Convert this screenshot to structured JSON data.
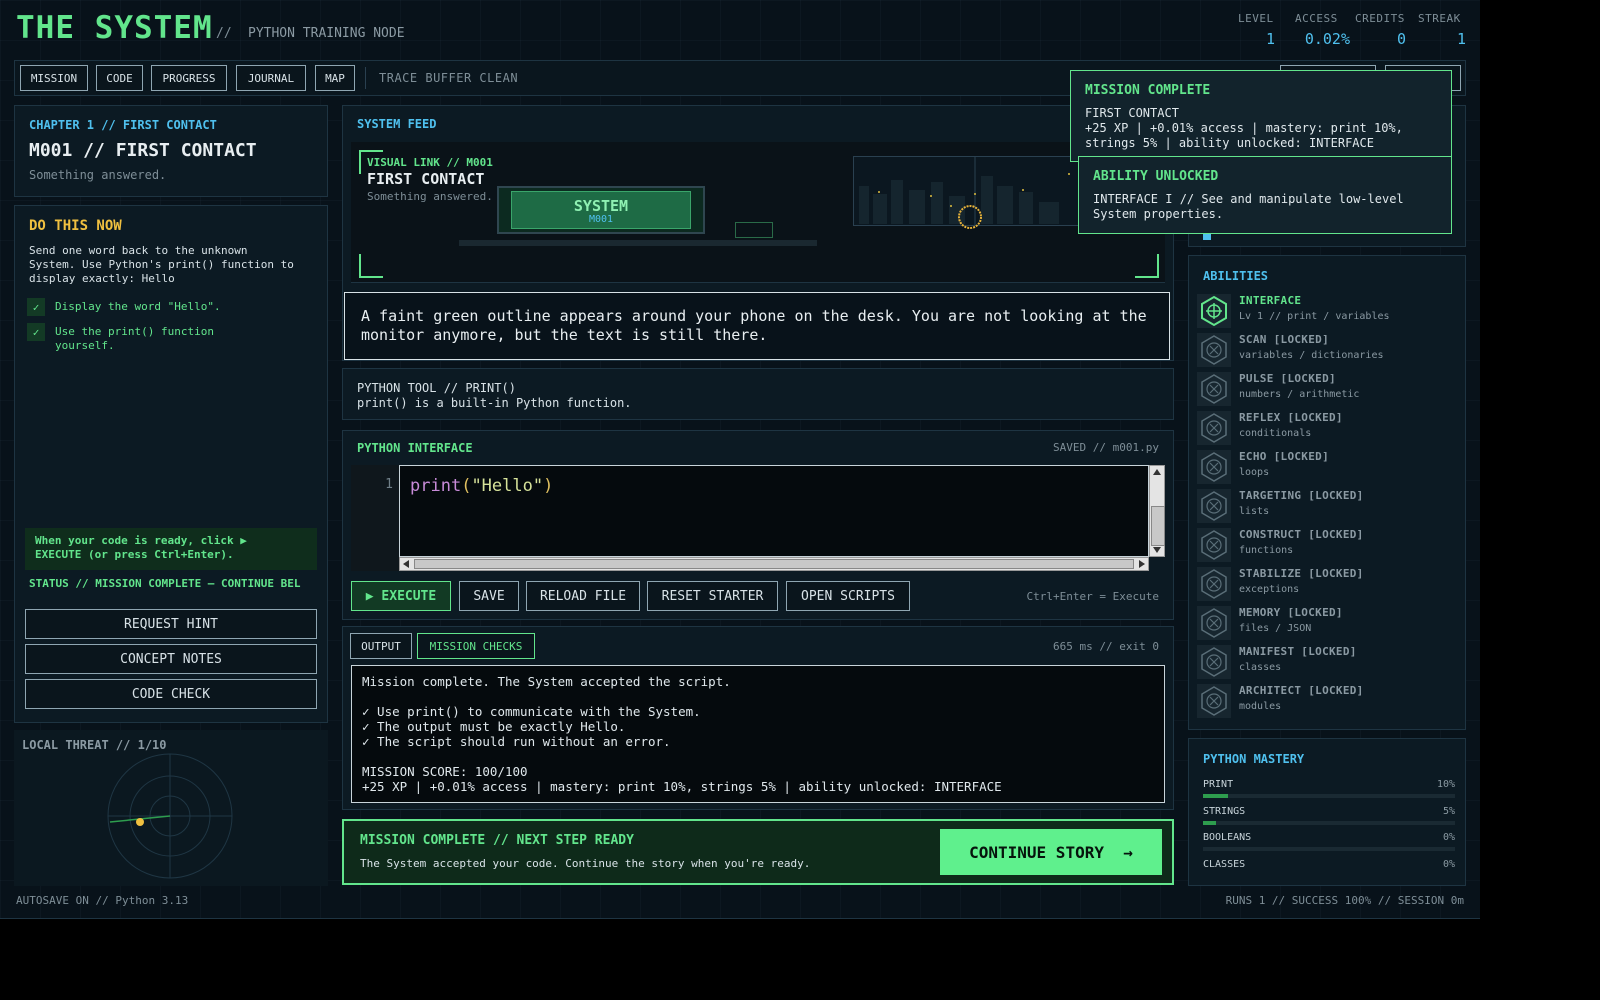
{
  "header": {
    "title": "THE SYSTEM",
    "sep": "//",
    "subtitle": "PYTHON TRAINING NODE",
    "stats": [
      {
        "label": "LEVEL",
        "value": "1"
      },
      {
        "label": "ACCESS",
        "value": "0.02%"
      },
      {
        "label": "CREDITS",
        "value": "0"
      },
      {
        "label": "STREAK",
        "value": "1"
      }
    ]
  },
  "nav": {
    "items": [
      "MISSION",
      "CODE",
      "PROGRESS",
      "JOURNAL",
      "MAP"
    ],
    "status": "TRACE BUFFER CLEAN"
  },
  "chapter": {
    "label": "CHAPTER 1 // FIRST CONTACT",
    "mission_title": "M001 // FIRST CONTACT",
    "tagline": "Something answered."
  },
  "task": {
    "heading": "DO THIS NOW",
    "body": "Send one word back to the unknown System. Use Python's print() function to display exactly: Hello",
    "checks": [
      {
        "mark": "✓",
        "text": "Display the word \"Hello\"."
      },
      {
        "mark": "✓",
        "text": "Use the print() function yourself."
      }
    ],
    "hint_box": "When your code is ready, click ▶ EXECUTE (or press Ctrl+Enter).",
    "status": "STATUS // MISSION COMPLETE — CONTINUE BEL",
    "buttons": [
      "REQUEST HINT",
      "CONCEPT NOTES",
      "CODE CHECK"
    ]
  },
  "threat": {
    "label": "LOCAL THREAT // 1/10",
    "level": 1,
    "max": 10
  },
  "feed": {
    "heading": "SYSTEM FEED",
    "visual_tag": "VISUAL LINK // M001",
    "visual_title": "FIRST CONTACT",
    "visual_sub": "Something answered.",
    "screen_title": "SYSTEM",
    "screen_sub": "M001",
    "narration": "A faint green outline appears around your phone on the desk. You are not looking at the monitor anymore, but the text is still there."
  },
  "tool": {
    "title": "PYTHON TOOL // PRINT()",
    "desc": "print() is a built-in Python function."
  },
  "editor": {
    "heading": "PYTHON INTERFACE",
    "saved": "SAVED // m001.py",
    "line_number": "1",
    "code_fn": "print",
    "code_open": "(",
    "code_str": "\"Hello\"",
    "code_close": ")",
    "execute": "▶ EXECUTE",
    "buttons": [
      "SAVE",
      "RELOAD FILE",
      "RESET STARTER",
      "OPEN SCRIPTS"
    ],
    "shortcut": "Ctrl+Enter = Execute"
  },
  "output": {
    "tabs": [
      "OUTPUT",
      "MISSION CHECKS"
    ],
    "meta": "665 ms // exit 0",
    "lines": [
      "Mission complete. The System accepted the script.",
      "",
      "✓ Use print() to communicate with the System.",
      "✓ The output must be exactly Hello.",
      "✓ The script should run without an error.",
      "",
      "MISSION SCORE: 100/100",
      "+25 XP | +0.01% access | mastery: print 10%, strings 5% | ability unlocked: INTERFACE"
    ]
  },
  "banner": {
    "title": "MISSION COMPLETE // NEXT STEP READY",
    "sub": "The System accepted your code. Continue the story when you're ready.",
    "button": "CONTINUE STORY  →"
  },
  "toasts": [
    {
      "title": "MISSION COMPLETE",
      "line1": "FIRST CONTACT",
      "line2": "+25 XP | +0.01% access | mastery: print 10%,",
      "line3": "strings 5% | ability unlocked: INTERFACE"
    },
    {
      "title": "ABILITY UNLOCKED",
      "line1": "INTERFACE I // See and manipulate low-level",
      "line2": "System properties."
    }
  ],
  "abilities": {
    "heading": "ABILITIES",
    "items": [
      {
        "name": "INTERFACE",
        "sub": "Lv 1 // print / variables",
        "unlocked": true
      },
      {
        "name": "SCAN [LOCKED]",
        "sub": "variables / dictionaries",
        "unlocked": false
      },
      {
        "name": "PULSE [LOCKED]",
        "sub": "numbers / arithmetic",
        "unlocked": false
      },
      {
        "name": "REFLEX [LOCKED]",
        "sub": "conditionals",
        "unlocked": false
      },
      {
        "name": "ECHO [LOCKED]",
        "sub": "loops",
        "unlocked": false
      },
      {
        "name": "TARGETING [LOCKED]",
        "sub": "lists",
        "unlocked": false
      },
      {
        "name": "CONSTRUCT [LOCKED]",
        "sub": "functions",
        "unlocked": false
      },
      {
        "name": "STABILIZE [LOCKED]",
        "sub": "exceptions",
        "unlocked": false
      },
      {
        "name": "MEMORY [LOCKED]",
        "sub": "files / JSON",
        "unlocked": false
      },
      {
        "name": "MANIFEST [LOCKED]",
        "sub": "classes",
        "unlocked": false
      },
      {
        "name": "ARCHITECT [LOCKED]",
        "sub": "modules",
        "unlocked": false
      }
    ]
  },
  "mastery": {
    "heading": "PYTHON MASTERY",
    "items": [
      {
        "name": "PRINT",
        "value": "10%",
        "fraction": 0.1
      },
      {
        "name": "STRINGS",
        "value": "5%",
        "fraction": 0.05
      },
      {
        "name": "BOOLEANS",
        "value": "0%",
        "fraction": 0
      },
      {
        "name": "CLASSES",
        "value": "0%",
        "fraction": 0
      }
    ]
  },
  "footer": {
    "left": "AUTOSAVE ON // Python 3.13",
    "right": "RUNS 1 // SUCCESS 100% // SESSION 0m"
  },
  "colors": {
    "accent": "#62e58c",
    "info": "#4fc0ee",
    "warn": "#f0c040",
    "bg": "#08121a"
  }
}
